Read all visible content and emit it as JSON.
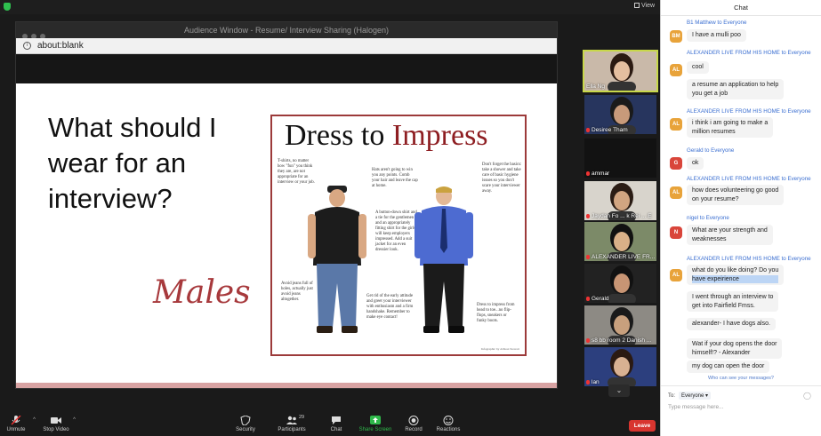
{
  "view_label": "View",
  "shared_window": {
    "title": "Audience Window - Resume/ Interview Sharing (Halogen)",
    "address": "about:blank"
  },
  "slide": {
    "question": "What should I wear for an interview?",
    "script_word": "Males",
    "poster": {
      "title_black": "Dress to ",
      "title_red": "Impress",
      "tips": [
        "T-shirts, no matter how \"fun\" you think they are, are not appropriate for an interview or your job.",
        "Hats aren't going to win you any points. Comb your hair and leave the cap at home.",
        "Don't forget the basics: take a shower and take care of basic hygiene issues so you don't scare your interviewer away.",
        "A button-down shirt and a tie for the gentlemen and an appropriately fitting shirt for the girls will keep employers impressed. Add a suit jacket for an even dressier look.",
        "Avoid jeans full of holes, actually just avoid jeans altogether.",
        "Get rid of the early attitude and greet your interviewer with enthusiasm and a firm handshake. Remember to make eye contact!",
        "Dress to impress from head to toe...no flip-flops, sneakers or funky boots."
      ],
      "credit": "Infographic by Allison Stewart"
    }
  },
  "gallery": [
    {
      "name": "Ella Ng",
      "muted": false,
      "bg": "#c9b9a9",
      "face": "#e5bfa0",
      "hair": "#2b1a12",
      "active": true
    },
    {
      "name": "Desiree Tham",
      "muted": true,
      "bg": "#27355e",
      "face": "#c89a7a",
      "hair": "#1a1a1a",
      "active": false
    },
    {
      "name": "ammar",
      "muted": true,
      "bg": "#121212",
      "face": null,
      "hair": null,
      "active": false
    },
    {
      "name": "Jaydan Fo ... k Rei ... E",
      "muted": true,
      "bg": "#d8d4cc",
      "face": "#d1a581",
      "hair": "#2a1c14",
      "active": false
    },
    {
      "name": "ALEXANDER LIVE FR...",
      "muted": true,
      "bg": "#7c8a68",
      "face": "#d9b088",
      "hair": "#111",
      "active": false
    },
    {
      "name": "Gerald",
      "muted": true,
      "bg": "#222",
      "face": "#c89574",
      "hair": "#111",
      "active": false
    },
    {
      "name": "s8 bb room 2 Danish ...",
      "muted": true,
      "bg": "#8d8a84",
      "face": "#c8a07d",
      "hair": "#1a1a1a",
      "active": false
    },
    {
      "name": "lan",
      "muted": true,
      "bg": "#2c3f7e",
      "face": "#d8b192",
      "hair": "#2b1a12",
      "active": false
    }
  ],
  "toolbar": {
    "unmute": "Unmute",
    "stop_video": "Stop Video",
    "security": "Security",
    "participants": "Participants",
    "participants_count": "29",
    "chat": "Chat",
    "share_screen": "Share Screen",
    "record": "Record",
    "reactions": "Reactions",
    "leave": "Leave"
  },
  "chat": {
    "title": "Chat",
    "messages": [
      {
        "sender": "B1 Matthew to Everyone",
        "avatar": "BM",
        "color": "#e8a33a",
        "lines": [
          "I have a mulli poo"
        ]
      },
      {
        "sender": "ALEXANDER LIVE FROM HIS HOME to Everyone",
        "avatar": "AL",
        "color": "#e8a33a",
        "lines": [
          "cool"
        ],
        "extra": [
          "a resume an application to help",
          "you get a job"
        ]
      },
      {
        "sender": "ALEXANDER LIVE FROM HIS HOME to Everyone",
        "avatar": "AL",
        "color": "#e8a33a",
        "lines": [
          "i think i am going to make a",
          "million resumes"
        ]
      },
      {
        "sender": "Gerald to Everyone",
        "avatar": "G",
        "color": "#d9453a",
        "lines": [
          "ok"
        ]
      },
      {
        "sender": "ALEXANDER LIVE FROM HIS HOME to Everyone",
        "avatar": "AL",
        "color": "#e8a33a",
        "lines": [
          "how does volunteering go good",
          "on your resume?"
        ]
      },
      {
        "sender": "nigel to Everyone",
        "avatar": "N",
        "color": "#d9453a",
        "lines": [
          "What are your strength and",
          "weaknesses"
        ]
      },
      {
        "sender": "ALEXANDER LIVE FROM HIS HOME to Everyone",
        "avatar": "AL",
        "color": "#e8a33a",
        "lines": [
          "what do you like doing? Do you",
          "have expeirience"
        ],
        "extra2": [
          [
            "I went through an interview to",
            "get into Fairfield Fmss."
          ],
          [
            "alexander- I have dogs also."
          ],
          [
            "Wat if your dog opens the door",
            "himself!? - Alexander"
          ],
          [
            "my dog can open the door"
          ]
        ]
      }
    ],
    "who_can_see": "Who can see your messages?",
    "to_label": "To:",
    "to_value": "Everyone",
    "input_placeholder": "Type message here..."
  }
}
